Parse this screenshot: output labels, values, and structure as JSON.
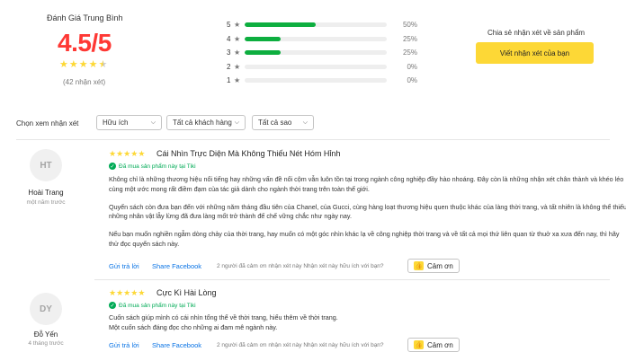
{
  "summary": {
    "label": "Đánh Giá Trung Bình",
    "score": "4.5/5",
    "stars": 4.5,
    "count": "(42 nhận xét)"
  },
  "distribution": [
    {
      "num": "5",
      "percent": 50,
      "label": "50%"
    },
    {
      "num": "4",
      "percent": 25,
      "label": "25%"
    },
    {
      "num": "3",
      "percent": 25,
      "label": "25%"
    },
    {
      "num": "2",
      "percent": 0,
      "label": "0%"
    },
    {
      "num": "1",
      "percent": 0,
      "label": "0%"
    }
  ],
  "share": {
    "label": "Chia sẻ nhận xét về sản phẩm",
    "button": "Viết nhận xét của bạn"
  },
  "filters": {
    "label": "Chọn xem nhận xét",
    "sort": "Hữu ích",
    "customers": "Tất cả khách hàng",
    "stars": "Tất cả sao"
  },
  "reviews": [
    {
      "initials": "HT",
      "name": "Hoài Trang",
      "time": "một năm trước",
      "stars": 5,
      "title": "Cái Nhìn Trực Diện Mà Không Thiếu Nét Hóm Hỉnh",
      "verified": "Đã mua sản phẩm này tại Tiki",
      "paragraphs": [
        "Không chỉ là những thương hiệu nổi tiếng hay những vấn đề nổi cộm vẫn luôn tồn tại trong ngành công nghiệp đầy hào nhoáng. Đây còn là những nhận xét chân thành và khéo léo cùng một ước mong rất điềm đạm của tác giả dành cho ngành thời trang trên toàn thế giới.",
        "Quyển sách còn đưa bạn đến với những năm tháng đầu tiên của Chanel, của Gucci, cùng hàng loạt thương hiệu quen thuộc khác của làng thời trang, và tất nhiên là không thể thiếu những nhân vật lẫy lừng đã đưa làng mốt trở thành đế chế vững chắc như ngày nay.",
        "Nếu bạn muốn nghiền ngẫm dòng chảy của thời trang, hay muốn có một góc nhìn khác lạ về công nghiệp thời trang và về tất cả mọi thứ liên quan từ thuở xa xưa đến nay, thì hãy thử đọc quyển sách này."
      ],
      "reply": "Gửi trả lời",
      "share": "Share Facebook",
      "helpful": "2 người đã cảm ơn nhận xét này Nhận xét này hữu ích với bạn?",
      "thanks": "Cảm ơn"
    },
    {
      "initials": "DY",
      "name": "Đỗ Yến",
      "time": "4 tháng trước",
      "stars": 5,
      "title": "Cực Kì Hài Lòng",
      "verified": "Đã mua sản phẩm này tại Tiki",
      "paragraphs": [
        "Cuốn sách giúp mình có cái nhìn tổng thể về thời trang, hiểu thêm về thời trang.",
        "Một cuốn sách đáng đọc cho những ai đam mê ngành này."
      ],
      "reply": "Gửi trả lời",
      "share": "Share Facebook",
      "helpful": "2 người đã cảm ơn nhận xét này Nhận xét này hữu ích với bạn?",
      "thanks": "Cảm ơn"
    }
  ],
  "colors": {
    "score": "#fe3834",
    "star": "#fdd836",
    "bar": "#0dae3f",
    "verified": "#00ab56",
    "link": "#0b74e5",
    "button": "#fdd836"
  }
}
